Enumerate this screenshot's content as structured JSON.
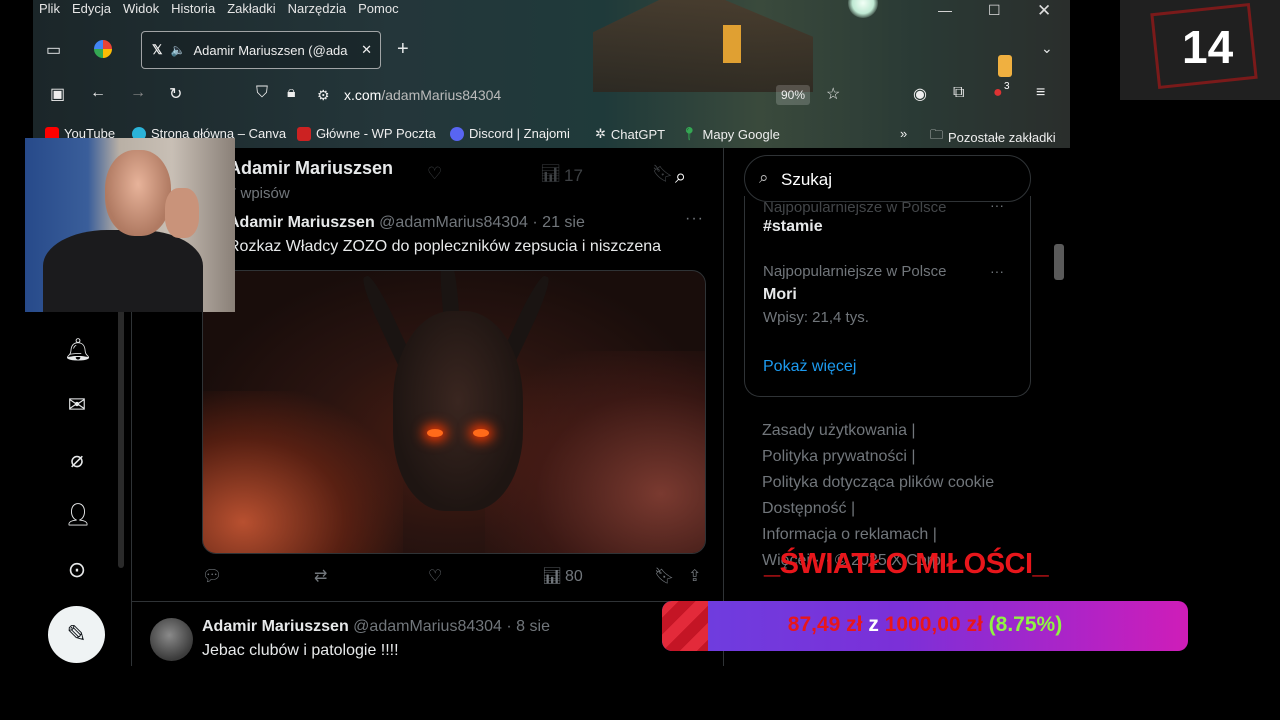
{
  "menu": [
    "Plik",
    "Edycja",
    "Widok",
    "Historia",
    "Zakładki",
    "Narzędzia",
    "Pomoc"
  ],
  "tab": {
    "title": "Adamir Mariuszsen (@ada"
  },
  "address": {
    "domain": "x.com",
    "path": "/adamMarius84304",
    "zoom": "90%"
  },
  "extension_badge": "3",
  "bookmarks": [
    "YouTube",
    "Strona główna – Canva",
    "Główne - WP Poczta",
    "Discord | Znajomi",
    "ChatGPT",
    "Mapy Google",
    "Pozostałe zakładki"
  ],
  "profile": {
    "name": "Adamir Mariuszsen",
    "posts": "7 wpisów"
  },
  "header_faded": {
    "views": "17"
  },
  "tweet1": {
    "name": "Adamir Mariuszsen",
    "handle": "@adamMarius84304",
    "date": "· 21 sie",
    "text": "Rozkaz Władcy ZOZO do popleczników zepsucia i niszczena",
    "views": "80"
  },
  "tweet2": {
    "name": "Adamir Mariuszsen",
    "handle": "@adamMarius84304",
    "date": "· 8 sie",
    "text": "Jebac clubów i patologie  !!!!"
  },
  "search": {
    "placeholder": "Szukaj"
  },
  "trends": [
    {
      "category": "Najpopularniejsze w Polsce",
      "name": "#stamie",
      "posts": ""
    },
    {
      "category": "Najpopularniejsze w Polsce",
      "name": "Mori",
      "posts": "Wpisy: 21,4 tys."
    }
  ],
  "show_more": "Pokaż więcej",
  "footer": [
    "Zasady użytkowania  |",
    "Polityka prywatności  |",
    "Polityka dotycząca plików cookie",
    "Dostępność  |",
    "Informacja o reklamach  |",
    "Więcej ···  © 2025 X Corp."
  ],
  "overlay": {
    "counter": "14",
    "goal_title": "_ŚWIATŁO MIŁOŚCI_",
    "raised": "87,49 zł",
    "of": "z",
    "target": "1000,00 zł",
    "percent": "(8.75%)",
    "progress": 0.0875
  },
  "colors": {
    "accent": "#1d9bf0",
    "goal_red": "#e8161b",
    "goal_green": "#8ff542"
  }
}
